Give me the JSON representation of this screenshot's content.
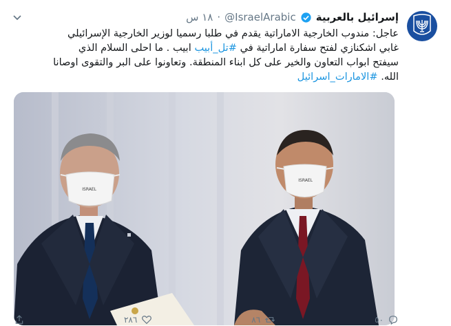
{
  "tweet": {
    "display_name": "إسرائيل بالعربية",
    "handle": "@IsraelArabic",
    "time": "١٨ س",
    "line1": "عاجل: مندوب الخارجية الاماراتية يقدم  في  طلبا رسميا لوزير الخارجية الإسرائيلي",
    "line2_pre": "غابي اشكنازي لفتح سفارة اماراتية في ",
    "line2_tag": "#تل_أبيب",
    "line2_post": " ابيب . ما احلى السلام  الذي",
    "line3": "سيفتح ابواب التعاون والخير على كل ابناء المنطقة. وتعاونوا على البر والتقوى اوصانا",
    "line4_pre": "الله.  ",
    "line4_tag": "#الامارات_اسرائيل",
    "mask_label_left": "ISRAEL",
    "mask_label_right": "ISRAEL"
  },
  "actions": {
    "reply_count": "٥٠",
    "retweet_count": "٨٦",
    "like_count": "٢٨٦"
  },
  "colors": {
    "link": "#1b95e0",
    "muted": "#657786",
    "avatar_bg": "#1a4fa0"
  }
}
